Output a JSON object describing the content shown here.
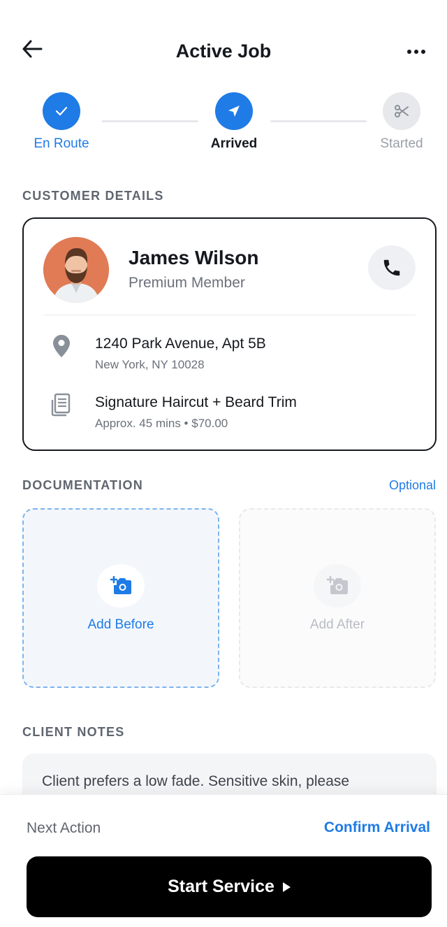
{
  "header": {
    "title": "Active Job"
  },
  "stepper": {
    "steps": [
      {
        "label": "En Route",
        "state": "done"
      },
      {
        "label": "Arrived",
        "state": "current"
      },
      {
        "label": "Started",
        "state": "upcoming"
      }
    ]
  },
  "customer": {
    "section_label": "CUSTOMER DETAILS",
    "name": "James Wilson",
    "tier": "Premium Member",
    "address_line1": "1240 Park Avenue, Apt 5B",
    "address_line2": "New York, NY 10028",
    "service_name": "Signature Haircut + Beard Trim",
    "service_meta": "Approx. 45 mins • $70.00"
  },
  "documentation": {
    "section_label": "DOCUMENTATION",
    "optional_label": "Optional",
    "before_label": "Add Before",
    "after_label": "Add After"
  },
  "notes": {
    "section_label": "CLIENT NOTES",
    "text": "Client prefers a low fade. Sensitive skin, please"
  },
  "bottom": {
    "next_label": "Next Action",
    "next_value": "Confirm Arrival",
    "primary_label": "Start Service"
  },
  "colors": {
    "accent": "#1f7be5",
    "text": "#15181d",
    "muted": "#6b717a",
    "primary_button": "#000000"
  }
}
